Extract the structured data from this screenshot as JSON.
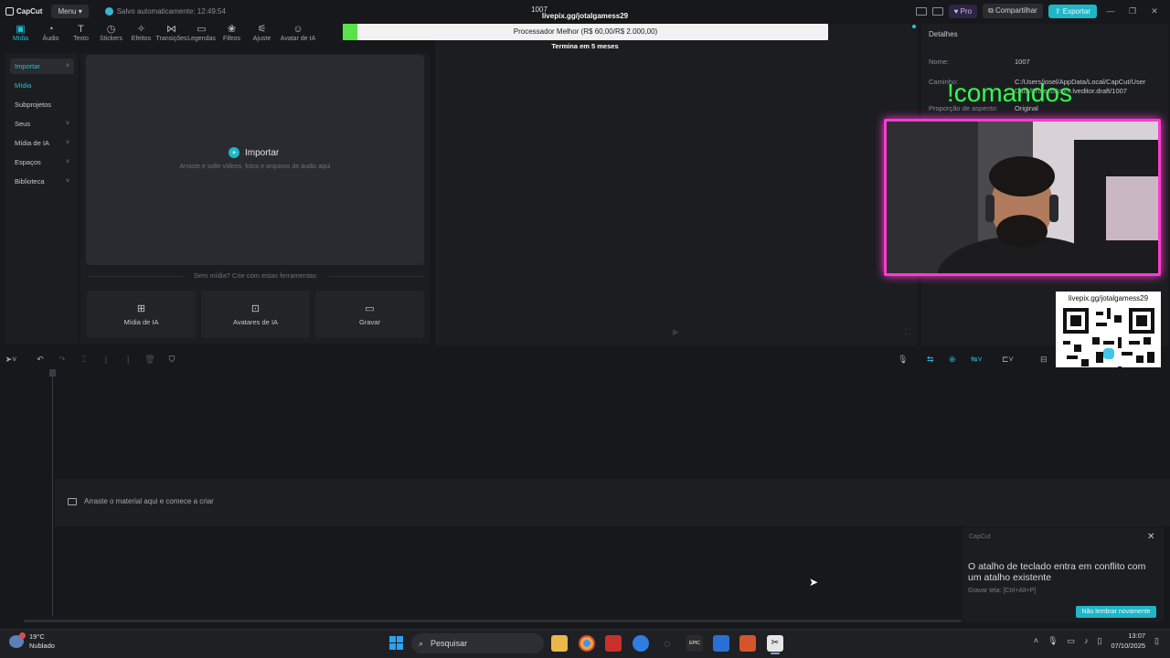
{
  "topbar": {
    "app_name": "CapCut",
    "menu_label": "Menu",
    "autosave_text": "Salvo automaticamente: 12:49:54",
    "project_name": "1007",
    "pro_label": "Pro",
    "share_label": "Compartilhar",
    "export_label": "Exportar"
  },
  "tabs": [
    {
      "label": "Mídia",
      "icon": "media-icon"
    },
    {
      "label": "Áudio",
      "icon": "audio-icon"
    },
    {
      "label": "Texto",
      "icon": "text-icon"
    },
    {
      "label": "Stickers",
      "icon": "sticker-icon"
    },
    {
      "label": "Efeitos",
      "icon": "effects-icon"
    },
    {
      "label": "Transições",
      "icon": "transition-icon"
    },
    {
      "label": "Legendas",
      "icon": "captions-icon"
    },
    {
      "label": "Filtros",
      "icon": "filter-icon"
    },
    {
      "label": "Ajuste",
      "icon": "adjust-icon"
    },
    {
      "label": "Avatar de IA",
      "icon": "avatar-icon"
    }
  ],
  "sidebar": {
    "items": [
      {
        "label": "Importar"
      },
      {
        "label": "Mídia"
      },
      {
        "label": "Subprojetos"
      },
      {
        "label": "Seus"
      },
      {
        "label": "Mídia de IA"
      },
      {
        "label": "Espaços"
      },
      {
        "label": "Biblioteca"
      }
    ]
  },
  "media": {
    "import_label": "Importar",
    "import_hint": "Arraste e solte vídeos, fotos e arquivos de áudio aqui",
    "no_media_text": "Sem mídia? Crie com estas ferramentas",
    "tools": [
      {
        "label": "Mídia de IA"
      },
      {
        "label": "Avatares de IA"
      },
      {
        "label": "Gravar"
      }
    ]
  },
  "overlay": {
    "livepix_top": "livepix.gg/jotalgamess29",
    "goal_text": "Processador Melhor (R$ 60,00/R$ 2.000,00)",
    "goal_progress": 0.03,
    "ends_text": "Termina em 5 meses",
    "commands_text": "!comandos",
    "qr_label": "livepix.gg/jotalgamess29"
  },
  "details": {
    "title": "Detalhes",
    "name_label": "Nome:",
    "name_value": "1007",
    "path_label": "Caminho:",
    "path_value": "C:/Users/josel/AppData/Local/CapCut/User Data/Projects/com.lveditor.draft/1007",
    "ratio_label": "Proporção de aspecto:",
    "ratio_value": "Original"
  },
  "timeline": {
    "drag_hint": "Arraste o material aqui e comece a criar"
  },
  "toast": {
    "app": "CapCut",
    "message": "O atalho de teclado entra em conflito com um atalho existente",
    "sub": "Gravar tela: [Ctrl+Alt+P]",
    "button": "Não lembrar novamente"
  },
  "taskbar": {
    "temperature": "19°C",
    "condition": "Nublado",
    "search_placeholder": "Pesquisar",
    "time": "13:07",
    "date": "07/10/2025"
  }
}
